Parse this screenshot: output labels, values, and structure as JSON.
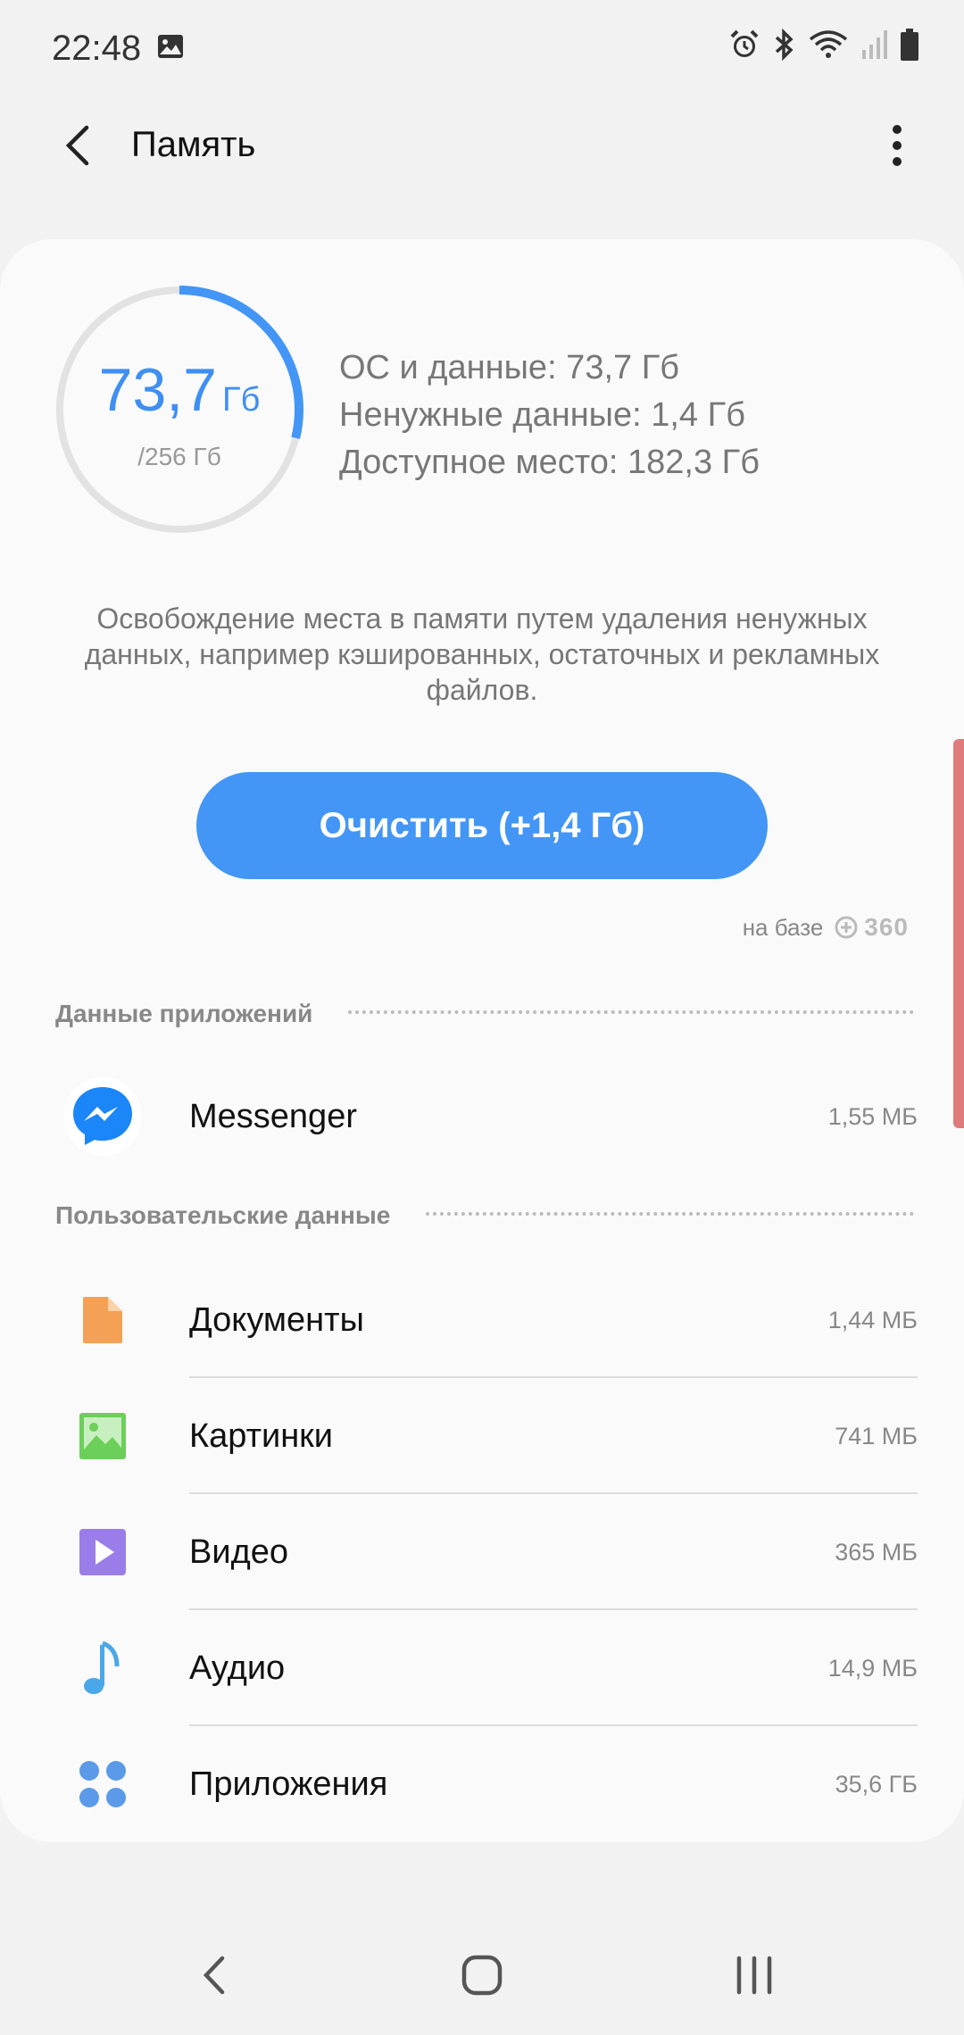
{
  "status": {
    "time": "22:48",
    "left_icons": [
      "image-icon"
    ],
    "right_icons": [
      "alarm-icon",
      "bluetooth-icon",
      "wifi-icon",
      "signal-icon",
      "battery-icon"
    ]
  },
  "header": {
    "title": "Память",
    "back_icon": "chevron-left-icon",
    "menu_icon": "more-vert-icon"
  },
  "storage": {
    "used_value": "73,7",
    "used_unit": "Гб",
    "total": "/256 Гб",
    "used_fraction": 0.288,
    "stats": {
      "os_data": "ОС и данные: 73,7 Гб",
      "junk": "Ненужные данные: 1,4 Гб",
      "available": "Доступное место: 182,3 Гб"
    },
    "description": "Освобождение места в памяти путем удаления ненужных данных, например кэшированных, остаточных и рекламных файлов.",
    "clean_button": "Очистить (+1,4 Гб)",
    "powered_by": "на базе",
    "powered_logo": "360"
  },
  "sections": {
    "app_data": {
      "title": "Данные приложений",
      "items": [
        {
          "label": "Messenger",
          "size": "1,55 МБ",
          "icon": "messenger-icon"
        }
      ]
    },
    "user_data": {
      "title": "Пользовательские данные",
      "items": [
        {
          "label": "Документы",
          "size": "1,44 МБ",
          "icon": "document-icon"
        },
        {
          "label": "Картинки",
          "size": "741 МБ",
          "icon": "image-icon"
        },
        {
          "label": "Видео",
          "size": "365 МБ",
          "icon": "video-icon"
        },
        {
          "label": "Аудио",
          "size": "14,9 МБ",
          "icon": "audio-icon"
        },
        {
          "label": "Приложения",
          "size": "35,6 ГБ",
          "icon": "apps-icon"
        }
      ]
    }
  },
  "colors": {
    "accent": "#4396f5",
    "documents": "#f5a155",
    "images": "#6ccf5a",
    "video": "#9a7de8",
    "audio": "#4aa8e8",
    "apps": "#5a9ae8"
  },
  "navbar": {
    "icons": [
      "back-nav-icon",
      "home-nav-icon",
      "recents-nav-icon"
    ]
  }
}
